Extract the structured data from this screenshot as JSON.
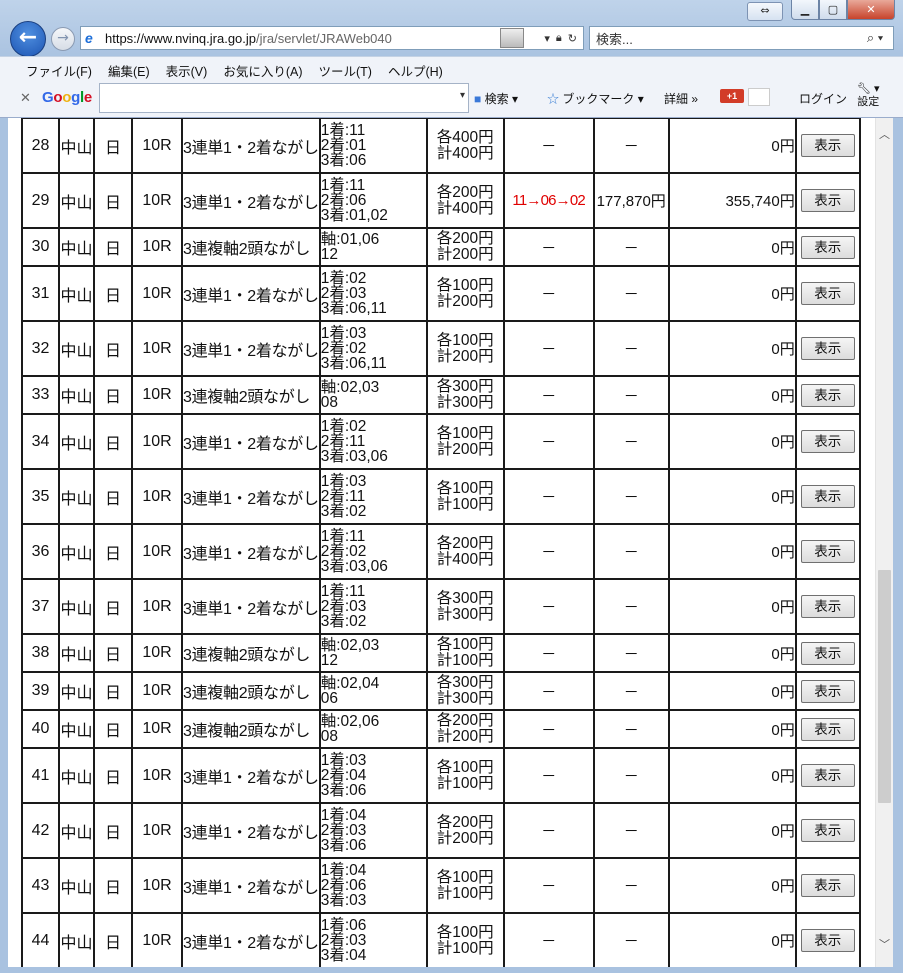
{
  "browser": {
    "url_host": "https://www.nvinq.jra.go.jp",
    "url_path": "/jra/servlet/JRAWeb040",
    "search_placeholder": "検索...",
    "menu": [
      "ファイル(F)",
      "編集(E)",
      "表示(V)",
      "お気に入り(A)",
      "ツール(T)",
      "ヘルプ(H)"
    ],
    "google_toolbar": {
      "logo": "Google",
      "search_label": "検索",
      "bookmark_label": "ブックマーク",
      "detail_label": "詳細",
      "gplus_label": "+1",
      "login_label": "ログイン",
      "settings_label": "設定"
    }
  },
  "table": {
    "rows": [
      {
        "no": "28",
        "place": "中山",
        "day": "日",
        "race": "10R",
        "type": "3連単1・2着ながし",
        "sel": [
          "1着:11",
          "2着:01",
          "3着:06"
        ],
        "amt": [
          "各400円",
          "計400円"
        ],
        "result": "－",
        "odds": "－",
        "payout": "0円",
        "button": "表示"
      },
      {
        "no": "29",
        "place": "中山",
        "day": "日",
        "race": "10R",
        "type": "3連単1・2着ながし",
        "sel": [
          "1着:11",
          "2着:06",
          "3着:01,02"
        ],
        "amt": [
          "各200円",
          "計400円"
        ],
        "result": "11→06→02",
        "hit": true,
        "odds": "177,870円",
        "payout": "355,740円",
        "button": "表示"
      },
      {
        "no": "30",
        "place": "中山",
        "day": "日",
        "race": "10R",
        "type": "3連複軸2頭ながし",
        "sel": [
          "軸:01,06",
          "12"
        ],
        "amt": [
          "各200円",
          "計200円"
        ],
        "result": "－",
        "odds": "－",
        "payout": "0円",
        "button": "表示"
      },
      {
        "no": "31",
        "place": "中山",
        "day": "日",
        "race": "10R",
        "type": "3連単1・2着ながし",
        "sel": [
          "1着:02",
          "2着:03",
          "3着:06,11"
        ],
        "amt": [
          "各100円",
          "計200円"
        ],
        "result": "－",
        "odds": "－",
        "payout": "0円",
        "button": "表示"
      },
      {
        "no": "32",
        "place": "中山",
        "day": "日",
        "race": "10R",
        "type": "3連単1・2着ながし",
        "sel": [
          "1着:03",
          "2着:02",
          "3着:06,11"
        ],
        "amt": [
          "各100円",
          "計200円"
        ],
        "result": "－",
        "odds": "－",
        "payout": "0円",
        "button": "表示"
      },
      {
        "no": "33",
        "place": "中山",
        "day": "日",
        "race": "10R",
        "type": "3連複軸2頭ながし",
        "sel": [
          "軸:02,03",
          "08"
        ],
        "amt": [
          "各300円",
          "計300円"
        ],
        "result": "－",
        "odds": "－",
        "payout": "0円",
        "button": "表示"
      },
      {
        "no": "34",
        "place": "中山",
        "day": "日",
        "race": "10R",
        "type": "3連単1・2着ながし",
        "sel": [
          "1着:02",
          "2着:11",
          "3着:03,06"
        ],
        "amt": [
          "各100円",
          "計200円"
        ],
        "result": "－",
        "odds": "－",
        "payout": "0円",
        "button": "表示"
      },
      {
        "no": "35",
        "place": "中山",
        "day": "日",
        "race": "10R",
        "type": "3連単1・2着ながし",
        "sel": [
          "1着:03",
          "2着:11",
          "3着:02"
        ],
        "amt": [
          "各100円",
          "計100円"
        ],
        "result": "－",
        "odds": "－",
        "payout": "0円",
        "button": "表示"
      },
      {
        "no": "36",
        "place": "中山",
        "day": "日",
        "race": "10R",
        "type": "3連単1・2着ながし",
        "sel": [
          "1着:11",
          "2着:02",
          "3着:03,06"
        ],
        "amt": [
          "各200円",
          "計400円"
        ],
        "result": "－",
        "odds": "－",
        "payout": "0円",
        "button": "表示"
      },
      {
        "no": "37",
        "place": "中山",
        "day": "日",
        "race": "10R",
        "type": "3連単1・2着ながし",
        "sel": [
          "1着:11",
          "2着:03",
          "3着:02"
        ],
        "amt": [
          "各300円",
          "計300円"
        ],
        "result": "－",
        "odds": "－",
        "payout": "0円",
        "button": "表示"
      },
      {
        "no": "38",
        "place": "中山",
        "day": "日",
        "race": "10R",
        "type": "3連複軸2頭ながし",
        "sel": [
          "軸:02,03",
          "12"
        ],
        "amt": [
          "各100円",
          "計100円"
        ],
        "result": "－",
        "odds": "－",
        "payout": "0円",
        "button": "表示"
      },
      {
        "no": "39",
        "place": "中山",
        "day": "日",
        "race": "10R",
        "type": "3連複軸2頭ながし",
        "sel": [
          "軸:02,04",
          "06"
        ],
        "amt": [
          "各300円",
          "計300円"
        ],
        "result": "－",
        "odds": "－",
        "payout": "0円",
        "button": "表示"
      },
      {
        "no": "40",
        "place": "中山",
        "day": "日",
        "race": "10R",
        "type": "3連複軸2頭ながし",
        "sel": [
          "軸:02,06",
          "08"
        ],
        "amt": [
          "各200円",
          "計200円"
        ],
        "result": "－",
        "odds": "－",
        "payout": "0円",
        "button": "表示"
      },
      {
        "no": "41",
        "place": "中山",
        "day": "日",
        "race": "10R",
        "type": "3連単1・2着ながし",
        "sel": [
          "1着:03",
          "2着:04",
          "3着:06"
        ],
        "amt": [
          "各100円",
          "計100円"
        ],
        "result": "－",
        "odds": "－",
        "payout": "0円",
        "button": "表示"
      },
      {
        "no": "42",
        "place": "中山",
        "day": "日",
        "race": "10R",
        "type": "3連単1・2着ながし",
        "sel": [
          "1着:04",
          "2着:03",
          "3着:06"
        ],
        "amt": [
          "各200円",
          "計200円"
        ],
        "result": "－",
        "odds": "－",
        "payout": "0円",
        "button": "表示"
      },
      {
        "no": "43",
        "place": "中山",
        "day": "日",
        "race": "10R",
        "type": "3連単1・2着ながし",
        "sel": [
          "1着:04",
          "2着:06",
          "3着:03"
        ],
        "amt": [
          "各100円",
          "計100円"
        ],
        "result": "－",
        "odds": "－",
        "payout": "0円",
        "button": "表示"
      },
      {
        "no": "44",
        "place": "中山",
        "day": "日",
        "race": "10R",
        "type": "3連単1・2着ながし",
        "sel": [
          "1着:06",
          "2着:03",
          "3着:04"
        ],
        "amt": [
          "各100円",
          "計100円"
        ],
        "result": "－",
        "odds": "－",
        "payout": "0円",
        "button": "表示"
      }
    ]
  },
  "colors": {
    "hit_result": "#e00000"
  }
}
